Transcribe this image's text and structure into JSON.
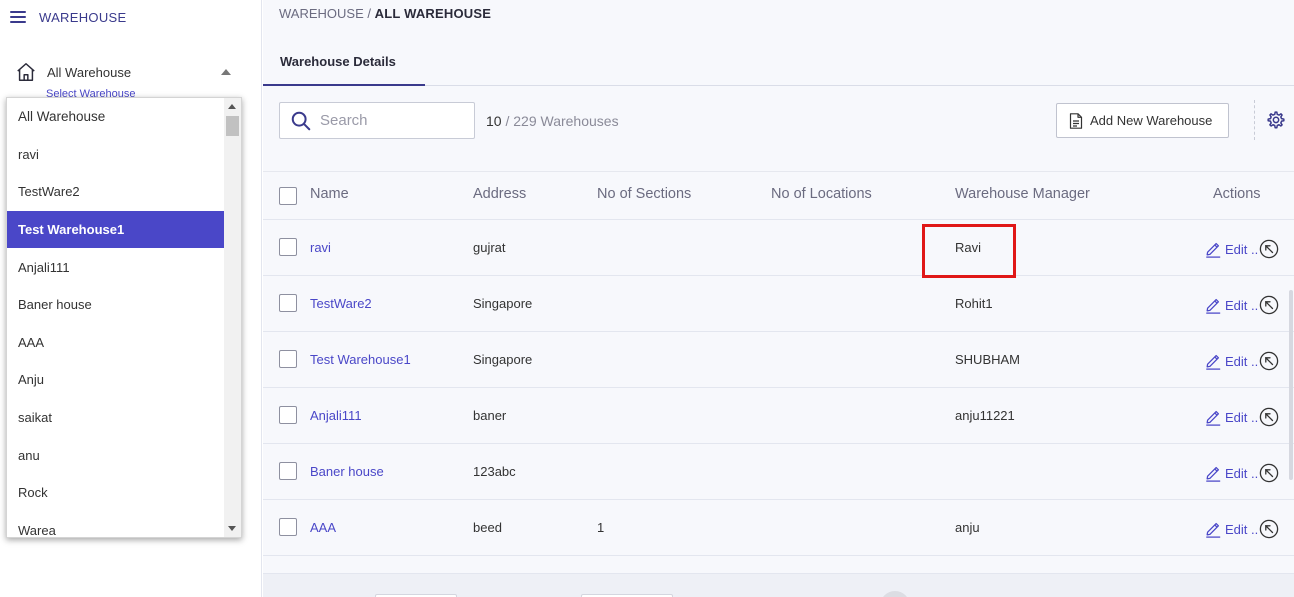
{
  "sidebar": {
    "title": "WAREHOUSE",
    "select_label": "All Warehouse",
    "select_hint": "Select Warehouse",
    "dropdown_items": [
      "All Warehouse",
      "ravi",
      "TestWare2",
      "Test Warehouse1",
      "Anjali111",
      "Baner house",
      "AAA",
      "Anju",
      "saikat",
      "anu",
      "Rock",
      "Warea"
    ],
    "selected_item": "Test Warehouse1"
  },
  "breadcrumb": {
    "root": "WAREHOUSE",
    "separator": "/",
    "current": "ALL WAREHOUSE"
  },
  "tabs": [
    {
      "label": "Warehouse Details"
    }
  ],
  "toolbar": {
    "search_placeholder": "Search",
    "count_current": "10",
    "count_separator": "/",
    "count_total": "229 Warehouses",
    "add_button": "Add New Warehouse"
  },
  "table": {
    "headers": {
      "name": "Name",
      "address": "Address",
      "sections": "No of Sections",
      "locations": "No of Locations",
      "manager": "Warehouse Manager",
      "actions": "Actions"
    },
    "action_label": "Edit ..",
    "rows": [
      {
        "name": "ravi",
        "address": "gujrat",
        "sections": "",
        "locations": "",
        "manager": "Ravi"
      },
      {
        "name": "TestWare2",
        "address": "Singapore",
        "sections": "",
        "locations": "",
        "manager": "Rohit1"
      },
      {
        "name": "Test Warehouse1",
        "address": "Singapore",
        "sections": "",
        "locations": "",
        "manager": "SHUBHAM"
      },
      {
        "name": "Anjali111",
        "address": "baner",
        "sections": "",
        "locations": "",
        "manager": "anju11221"
      },
      {
        "name": "Baner house",
        "address": "123abc",
        "sections": "",
        "locations": "",
        "manager": ""
      },
      {
        "name": "AAA",
        "address": "beed",
        "sections": "1",
        "locations": "",
        "manager": "anju"
      }
    ]
  },
  "colors": {
    "accent": "#4a47c8",
    "highlight": "#e01717"
  },
  "icons": [
    "menu-icon",
    "home-icon",
    "search-icon",
    "document-icon",
    "gear-icon",
    "edit-icon",
    "arrow-up-left-circle-icon"
  ]
}
